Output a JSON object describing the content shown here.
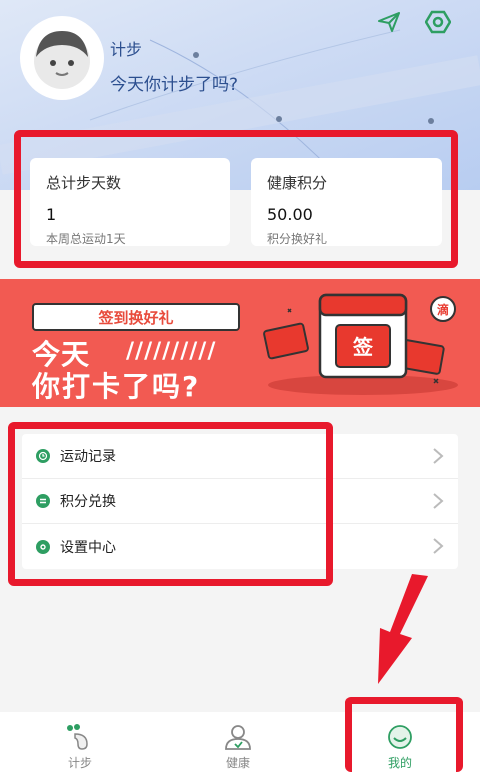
{
  "header": {
    "username": "计步",
    "motto": "今天你计步了吗?",
    "icons": [
      "send-icon",
      "settings-hex-icon"
    ]
  },
  "stats": [
    {
      "title": "总计步天数",
      "value": "1",
      "sub": "本周总运动1天"
    },
    {
      "title": "健康积分",
      "value": "50.00",
      "sub": "积分换好礼"
    }
  ],
  "banner": {
    "tag": "签到换好礼",
    "line1": "今天",
    "slashes": "//////////",
    "line2": "你打卡了吗?",
    "badge": "签",
    "bubble": "滴"
  },
  "menu": {
    "items": [
      {
        "label": "运动记录",
        "icon": "clock-icon"
      },
      {
        "label": "积分兑换",
        "icon": "exchange-icon"
      },
      {
        "label": "设置中心",
        "icon": "settings-icon"
      }
    ]
  },
  "tabbar": {
    "tabs": [
      {
        "label": "计步",
        "icon": "footprint-icon",
        "active": false
      },
      {
        "label": "健康",
        "icon": "health-person-icon",
        "active": false
      },
      {
        "label": "我的",
        "icon": "smile-icon",
        "active": true
      }
    ]
  },
  "colors": {
    "accent_green": "#2e9e62",
    "highlight_red": "#e8192c",
    "banner_red": "#f25a52",
    "header_blue": "#c9d8f3"
  }
}
